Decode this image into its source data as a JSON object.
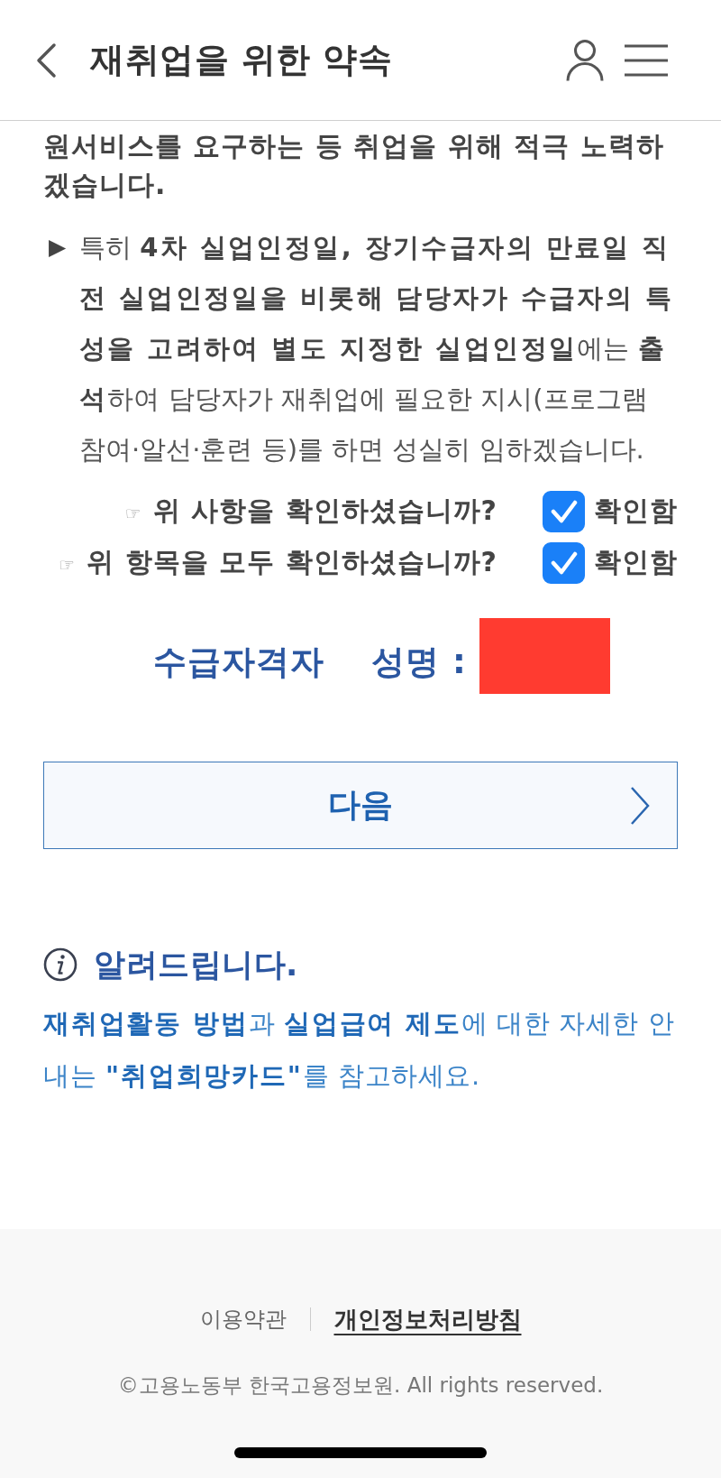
{
  "header": {
    "title": "재취업을 위한 약속"
  },
  "pledge": {
    "continued_text": "원서비스를 요구하는 등 취업을 위해 적극 노력하겠습니다.",
    "bullet": "▶",
    "bullet_text": "특히 **4차 실업인정일, 장기수급자의 만료일 직전 실업인정일을 비롯해 담당자가 수급자의 특성을 고려하여 별도 지정한 실업인정일**에는 **출석**하여 담당자가 재취업에 필요한 지시(프로그램 참여·알선·훈련 등)를 하면 성실히 임하겠습니다."
  },
  "confirmations": [
    {
      "pointer": "☞",
      "question": "위 사항을 확인하셨습니까?",
      "checked": true,
      "label": "확인함"
    },
    {
      "pointer": "☞",
      "question": "위 항목을 모두 확인하셨습니까?",
      "checked": true,
      "label": "확인함"
    }
  ],
  "recipient": {
    "title": "수급자격자",
    "name_label": "성명 :",
    "name_redacted": true
  },
  "next_button": {
    "label": "다음"
  },
  "notice": {
    "title": "알려드립니다.",
    "text": "**재취업활동 방법**과 **실업급여 제도**에 대한 자세한 안내는 **\"취업희망카드\"**를 참고하세요."
  },
  "footer": {
    "links": [
      {
        "label": "이용약관",
        "emphasized": false
      },
      {
        "label": "개인정보처리방침",
        "emphasized": true
      }
    ],
    "copyright": "©고용노동부 한국고용정보원. All rights reserved."
  }
}
